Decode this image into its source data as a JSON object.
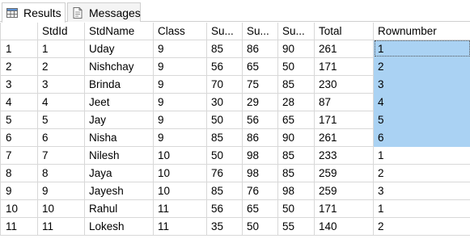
{
  "tabs": [
    {
      "label": "Results",
      "icon": "grid-icon",
      "active": true
    },
    {
      "label": "Messages",
      "icon": "messages-icon",
      "active": false
    }
  ],
  "grid": {
    "columns": [
      "",
      "StdId",
      "StdName",
      "Class",
      "Su...",
      "Su...",
      "Su...",
      "Total",
      "Rownumber"
    ],
    "rows": [
      {
        "n": "1",
        "cells": [
          "1",
          "Uday",
          "9",
          "85",
          "86",
          "90",
          "261",
          "1"
        ]
      },
      {
        "n": "2",
        "cells": [
          "2",
          "Nishchay",
          "9",
          "56",
          "65",
          "50",
          "171",
          "2"
        ]
      },
      {
        "n": "3",
        "cells": [
          "3",
          "Brinda",
          "9",
          "70",
          "75",
          "85",
          "230",
          "3"
        ]
      },
      {
        "n": "4",
        "cells": [
          "4",
          "Jeet",
          "9",
          "30",
          "29",
          "28",
          "87",
          "4"
        ]
      },
      {
        "n": "5",
        "cells": [
          "5",
          "Jay",
          "9",
          "50",
          "56",
          "65",
          "171",
          "5"
        ]
      },
      {
        "n": "6",
        "cells": [
          "6",
          "Nisha",
          "9",
          "85",
          "86",
          "90",
          "261",
          "6"
        ]
      },
      {
        "n": "7",
        "cells": [
          "7",
          "Nilesh",
          "10",
          "50",
          "98",
          "85",
          "233",
          "1"
        ]
      },
      {
        "n": "8",
        "cells": [
          "8",
          "Jaya",
          "10",
          "76",
          "98",
          "85",
          "259",
          "2"
        ]
      },
      {
        "n": "9",
        "cells": [
          "9",
          "Jayesh",
          "10",
          "85",
          "76",
          "98",
          "259",
          "3"
        ]
      },
      {
        "n": "10",
        "cells": [
          "10",
          "Rahul",
          "11",
          "56",
          "65",
          "50",
          "171",
          "1"
        ]
      },
      {
        "n": "11",
        "cells": [
          "11",
          "Lokesh",
          "11",
          "35",
          "50",
          "55",
          "140",
          "2"
        ]
      }
    ],
    "selection_color": "#aad2f3"
  }
}
